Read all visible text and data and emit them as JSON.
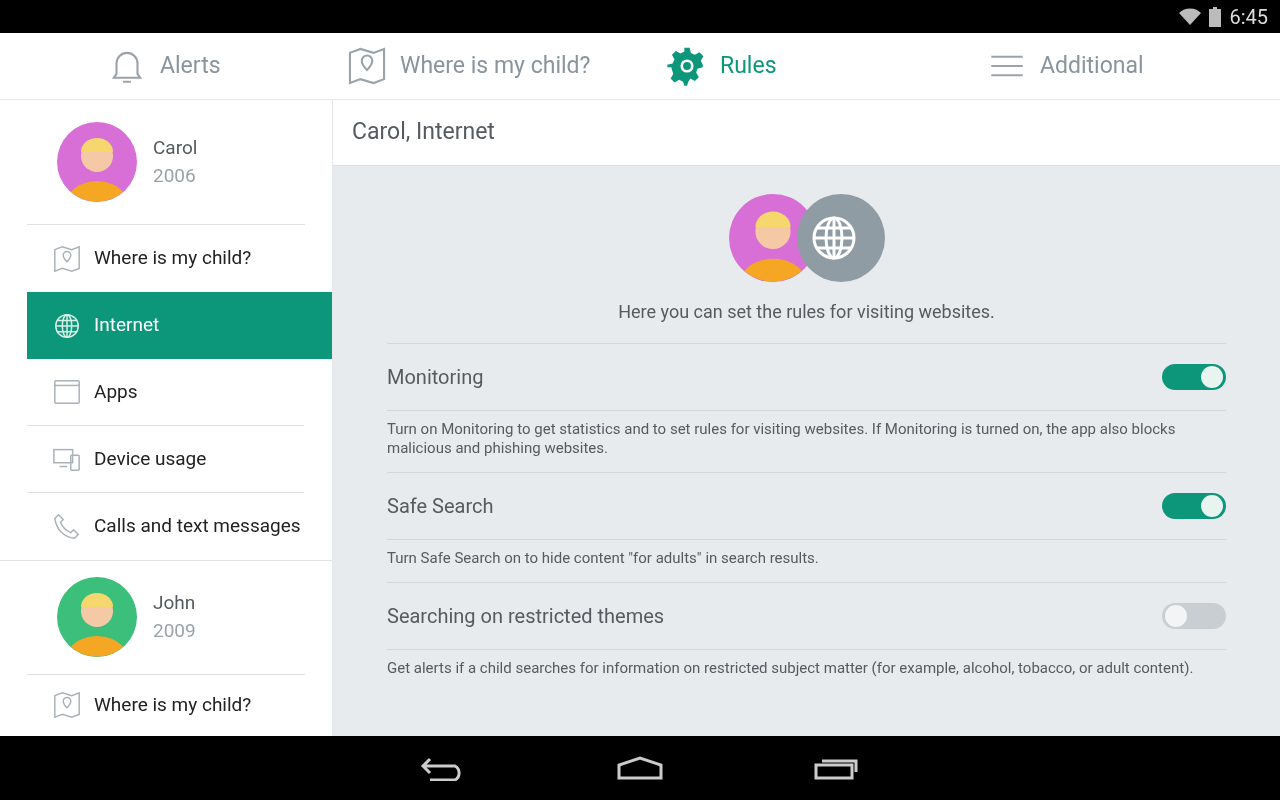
{
  "status_bar": {
    "time": "6:45"
  },
  "tabs": [
    {
      "label": "Alerts",
      "kind": "bell",
      "selected": false
    },
    {
      "label": "Where is my child?",
      "kind": "map",
      "selected": false
    },
    {
      "label": "Rules",
      "kind": "gear",
      "selected": true
    },
    {
      "label": "Additional",
      "kind": "menu",
      "selected": false
    }
  ],
  "children": [
    {
      "name": "Carol",
      "year": "2006",
      "color": "#d86fd6",
      "items": [
        {
          "label": "Where is my child?",
          "kind": "map",
          "selected": false
        },
        {
          "label": "Internet",
          "kind": "globe",
          "selected": true
        },
        {
          "label": "Apps",
          "kind": "window",
          "selected": false
        },
        {
          "label": "Device usage",
          "kind": "devices",
          "selected": false
        },
        {
          "label": "Calls and text messages",
          "kind": "phone",
          "selected": false
        }
      ]
    },
    {
      "name": "John",
      "year": "2009",
      "color": "#3dbf7c",
      "items": [
        {
          "label": "Where is my child?",
          "kind": "map",
          "selected": false
        }
      ]
    }
  ],
  "content": {
    "title": "Carol, Internet",
    "intro": "Here you can set the rules for visiting websites.",
    "avatar": {
      "color": "#d86fd6"
    },
    "settings": [
      {
        "title": "Monitoring",
        "on": true,
        "description": "Turn on Monitoring to get statistics and to set rules for visiting websites. If Monitoring is turned on, the app also blocks malicious and phishing websites."
      },
      {
        "title": "Safe Search",
        "on": true,
        "description": "Turn Safe Search on to hide content \"for adults\" in search results."
      },
      {
        "title": "Searching on restricted themes",
        "on": false,
        "description": "Get alerts if a child searches for information on restricted subject matter (for example, alcohol, tobacco, or adult content)."
      }
    ]
  }
}
